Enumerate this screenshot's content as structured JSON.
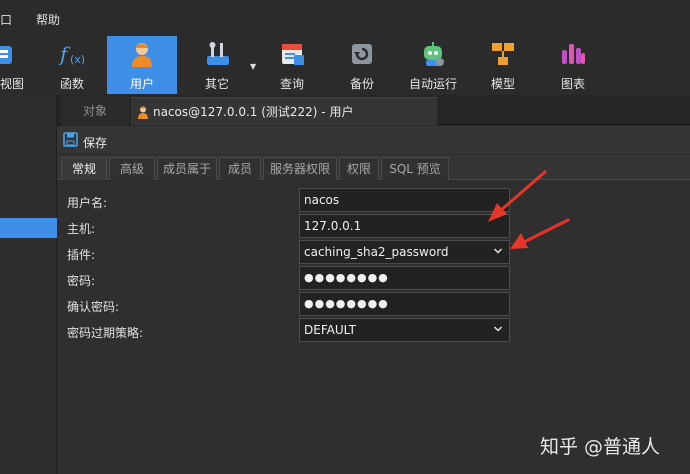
{
  "menu": {
    "items": [
      "口",
      "帮助"
    ]
  },
  "toolbar": {
    "items": [
      {
        "label": "视图",
        "icon": "view-icon"
      },
      {
        "label": "函数",
        "icon": "function-icon"
      },
      {
        "label": "用户",
        "icon": "user-icon"
      },
      {
        "label": "其它",
        "icon": "tools-icon"
      },
      {
        "label": "查询",
        "icon": "query-icon"
      },
      {
        "label": "备份",
        "icon": "backup-icon"
      },
      {
        "label": "自动运行",
        "icon": "robot-icon"
      },
      {
        "label": "模型",
        "icon": "model-icon"
      },
      {
        "label": "图表",
        "icon": "chart-icon"
      }
    ],
    "active": "用户",
    "accent": "#3d8fe8"
  },
  "tabs": {
    "objects": "对象",
    "active_title": "nacos@127.0.0.1 (测试222) - 用户"
  },
  "savebar": {
    "save_label": "保存"
  },
  "subtabs": [
    "常规",
    "高级",
    "成员属于",
    "成员",
    "服务器权限",
    "权限",
    "SQL 预览"
  ],
  "form": {
    "username_label": "用户名:",
    "username_value": "nacos",
    "host_label": "主机:",
    "host_value": "127.0.0.1",
    "plugin_label": "插件:",
    "plugin_value": "caching_sha2_password",
    "password_label": "密码:",
    "password_value": "●●●●●●●●",
    "confirm_label": "确认密码:",
    "confirm_value": "●●●●●●●●",
    "expire_label": "密码过期策略:",
    "expire_value": "DEFAULT"
  },
  "annotation": {
    "arrow_color": "#e8352a"
  },
  "watermark": "知乎 @普通人"
}
